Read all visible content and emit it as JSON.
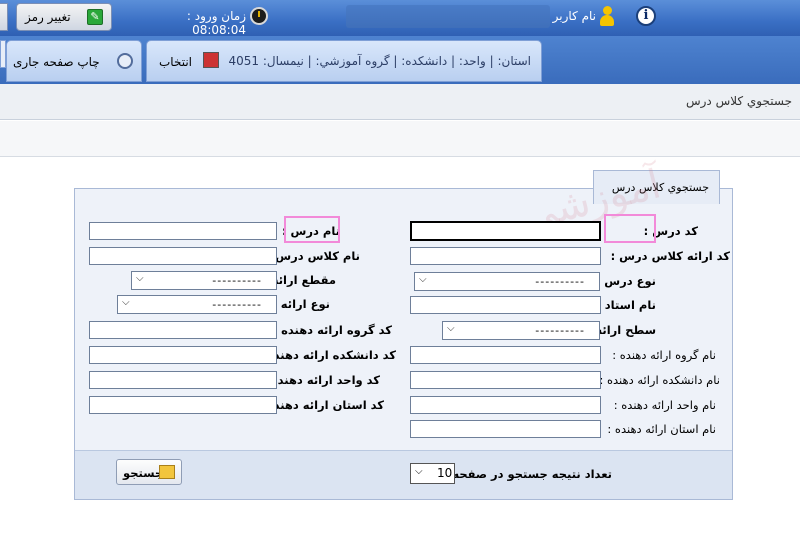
{
  "header": {
    "user_label": "نام كاربر",
    "login_time_label": "زمان ورود : 08:08:04",
    "change_password": "تغییر رمز"
  },
  "nav": {
    "print_page": "چاپ صفحه جاری",
    "context_path": "استان: | واحد: | دانشكده: | گروه آموزشي: | نيمسال: 4051",
    "select_label": "انتخاب"
  },
  "breadcrumb": "جستجوي كلاس درس",
  "panel": {
    "title": "جستجوي كلاس درس",
    "right_fields": [
      {
        "label": "كد درس :"
      },
      {
        "label": "كد ارائه كلاس درس :"
      },
      {
        "label": "نوع درس :",
        "value": "----------"
      },
      {
        "label": "نام استاد :"
      },
      {
        "label": "سطح ارائه :",
        "value": "----------"
      },
      {
        "label": "نام گروه ارائه دهنده :"
      },
      {
        "label": "نام دانشكده ارائه دهنده :"
      },
      {
        "label": "نام واحد ارائه دهنده :"
      },
      {
        "label": "نام استان ارائه دهنده :"
      }
    ],
    "left_fields": [
      {
        "label": "نام درس :"
      },
      {
        "label": "نام كلاس درس :"
      },
      {
        "label": "مقطع ارائه :",
        "value": "----------"
      },
      {
        "label": "نوع ارائه :",
        "value": "----------"
      },
      {
        "label": "كد گروه ارائه دهنده :"
      },
      {
        "label": "كد دانشكده ارائه دهنده :"
      },
      {
        "label": "كد واحد ارائه دهنده :"
      },
      {
        "label": "كد استان ارائه دهنده :"
      }
    ],
    "results_per_page_label": "تعداد نتيجه جستجو در صفحه:",
    "results_per_page_value": "10",
    "search_button": "جستجو"
  },
  "colors": {
    "header_blue": "#3a6fc4",
    "highlight_pink": "#f28ad9"
  }
}
